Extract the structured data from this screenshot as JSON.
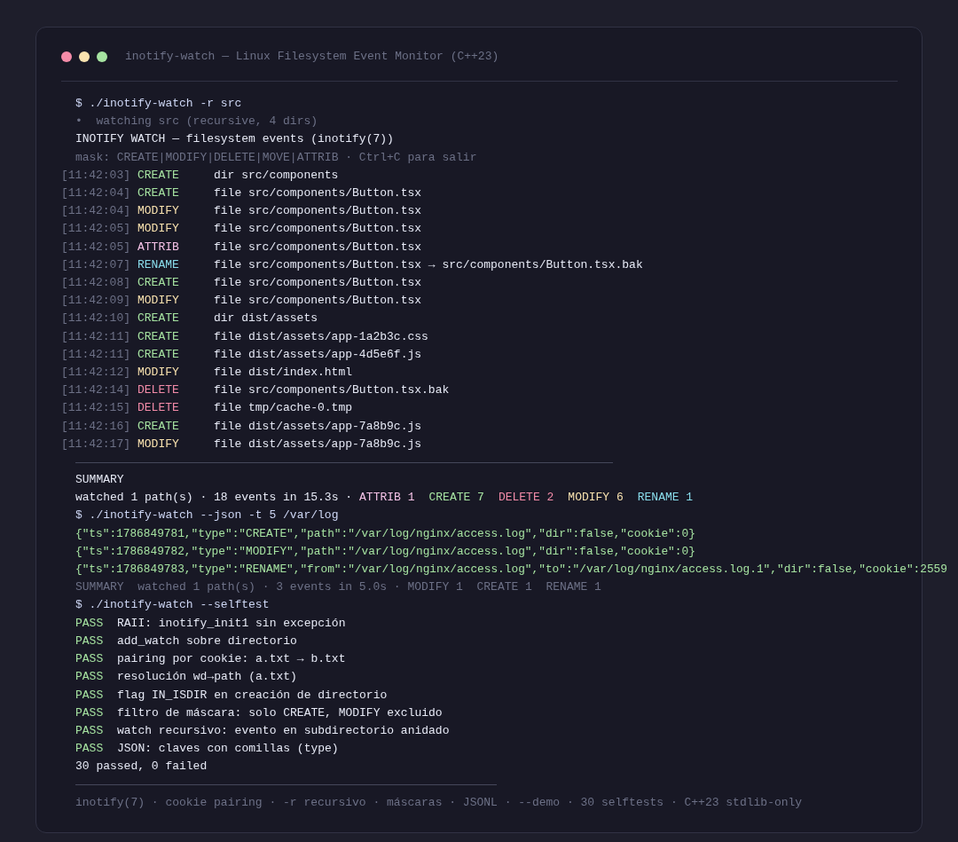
{
  "window": {
    "title": "inotify-watch — Linux Filesystem Event Monitor (C++23)"
  },
  "session": [
    {
      "kind": "command",
      "text": "$ ./inotify-watch -r src"
    },
    {
      "kind": "info",
      "text": "•  watching src (recursive, 4 dirs)"
    },
    {
      "kind": "heading",
      "text": "INOTIFY WATCH — filesystem events (inotify(7))"
    },
    {
      "kind": "dim",
      "text": "mask: CREATE|MODIFY|DELETE|MOVE|ATTRIB · Ctrl+C para salir"
    },
    {
      "kind": "event",
      "time": "[11:42:03]",
      "type": "CREATE",
      "color": "#a6e3a1",
      "detail": "dir src/components"
    },
    {
      "kind": "event",
      "time": "[11:42:04]",
      "type": "CREATE",
      "color": "#a6e3a1",
      "detail": "file src/components/Button.tsx"
    },
    {
      "kind": "event",
      "time": "[11:42:04]",
      "type": "MODIFY",
      "color": "#f9e2af",
      "detail": "file src/components/Button.tsx"
    },
    {
      "kind": "event",
      "time": "[11:42:05]",
      "type": "MODIFY",
      "color": "#f9e2af",
      "detail": "file src/components/Button.tsx"
    },
    {
      "kind": "event",
      "time": "[11:42:05]",
      "type": "ATTRIB",
      "color": "#f5c2e7",
      "detail": "file src/components/Button.tsx"
    },
    {
      "kind": "event",
      "time": "[11:42:07]",
      "type": "RENAME",
      "color": "#89dceb",
      "detail": "file src/components/Button.tsx → src/components/Button.tsx.bak"
    },
    {
      "kind": "event",
      "time": "[11:42:08]",
      "type": "CREATE",
      "color": "#a6e3a1",
      "detail": "file src/components/Button.tsx"
    },
    {
      "kind": "event",
      "time": "[11:42:09]",
      "type": "MODIFY",
      "color": "#f9e2af",
      "detail": "file src/components/Button.tsx"
    },
    {
      "kind": "event",
      "time": "[11:42:10]",
      "type": "CREATE",
      "color": "#a6e3a1",
      "detail": "dir dist/assets"
    },
    {
      "kind": "event",
      "time": "[11:42:11]",
      "type": "CREATE",
      "color": "#a6e3a1",
      "detail": "file dist/assets/app-1a2b3c.css"
    },
    {
      "kind": "event",
      "time": "[11:42:11]",
      "type": "CREATE",
      "color": "#a6e3a1",
      "detail": "file dist/assets/app-4d5e6f.js"
    },
    {
      "kind": "event",
      "time": "[11:42:12]",
      "type": "MODIFY",
      "color": "#f9e2af",
      "detail": "file dist/index.html"
    },
    {
      "kind": "event",
      "time": "[11:42:14]",
      "type": "DELETE",
      "color": "#f38ba8",
      "detail": "file src/components/Button.tsx.bak"
    },
    {
      "kind": "event",
      "time": "[11:42:15]",
      "type": "DELETE",
      "color": "#f38ba8",
      "detail": "file tmp/cache-0.tmp"
    },
    {
      "kind": "event",
      "time": "[11:42:16]",
      "type": "CREATE",
      "color": "#a6e3a1",
      "detail": "file dist/assets/app-7a8b9c.js"
    },
    {
      "kind": "event",
      "time": "[11:42:17]",
      "type": "MODIFY",
      "color": "#f9e2af",
      "detail": "file dist/assets/app-7a8b9c.js"
    },
    {
      "kind": "rule"
    },
    {
      "kind": "plain",
      "text": "SUMMARY"
    },
    {
      "kind": "summary",
      "text": "watched 1 path(s) · 18 events in 15.3s ·",
      "counts": [
        {
          "label": "ATTRIB 1",
          "color": "#f5c2e7"
        },
        {
          "label": "CREATE 7",
          "color": "#a6e3a1"
        },
        {
          "label": "DELETE 2",
          "color": "#f38ba8"
        },
        {
          "label": "MODIFY 6",
          "color": "#f9e2af"
        },
        {
          "label": "RENAME 1",
          "color": "#89dceb"
        }
      ]
    },
    {
      "kind": "command",
      "text": "$ ./inotify-watch --json -t 5 /var/log"
    },
    {
      "kind": "json",
      "text": "{\"ts\":1786849781,\"type\":\"CREATE\",\"path\":\"/var/log/nginx/access.log\",\"dir\":false,\"cookie\":0}"
    },
    {
      "kind": "json",
      "text": "{\"ts\":1786849782,\"type\":\"MODIFY\",\"path\":\"/var/log/nginx/access.log\",\"dir\":false,\"cookie\":0}"
    },
    {
      "kind": "json",
      "text": "{\"ts\":1786849783,\"type\":\"RENAME\",\"from\":\"/var/log/nginx/access.log\",\"to\":\"/var/log/nginx/access.log.1\",\"dir\":false,\"cookie\":2559"
    },
    {
      "kind": "dim",
      "text": "SUMMARY  watched 1 path(s) · 3 events in 5.0s · MODIFY 1  CREATE 1  RENAME 1"
    },
    {
      "kind": "command",
      "text": "$ ./inotify-watch --selftest"
    },
    {
      "kind": "pass",
      "status": "PASS",
      "text": "RAII: inotify_init1 sin excepción"
    },
    {
      "kind": "pass",
      "status": "PASS",
      "text": "add_watch sobre directorio"
    },
    {
      "kind": "pass",
      "status": "PASS",
      "text": "pairing por cookie: a.txt → b.txt"
    },
    {
      "kind": "pass",
      "status": "PASS",
      "text": "resolución wd→path (a.txt)"
    },
    {
      "kind": "pass",
      "status": "PASS",
      "text": "flag IN_ISDIR en creación de directorio"
    },
    {
      "kind": "pass",
      "status": "PASS",
      "text": "filtro de máscara: solo CREATE, MODIFY excluido"
    },
    {
      "kind": "pass",
      "status": "PASS",
      "text": "watch recursivo: evento en subdirectorio anidado"
    },
    {
      "kind": "pass",
      "status": "PASS",
      "text": "JSON: claves con comillas (type)"
    },
    {
      "kind": "plain",
      "text": "30 passed, 0 failed"
    },
    {
      "kind": "rule_short"
    },
    {
      "kind": "dim",
      "text": "inotify(7) · cookie pairing · -r recursivo · máscaras · JSONL · --demo · 30 selftests · C++23 stdlib-only"
    }
  ]
}
